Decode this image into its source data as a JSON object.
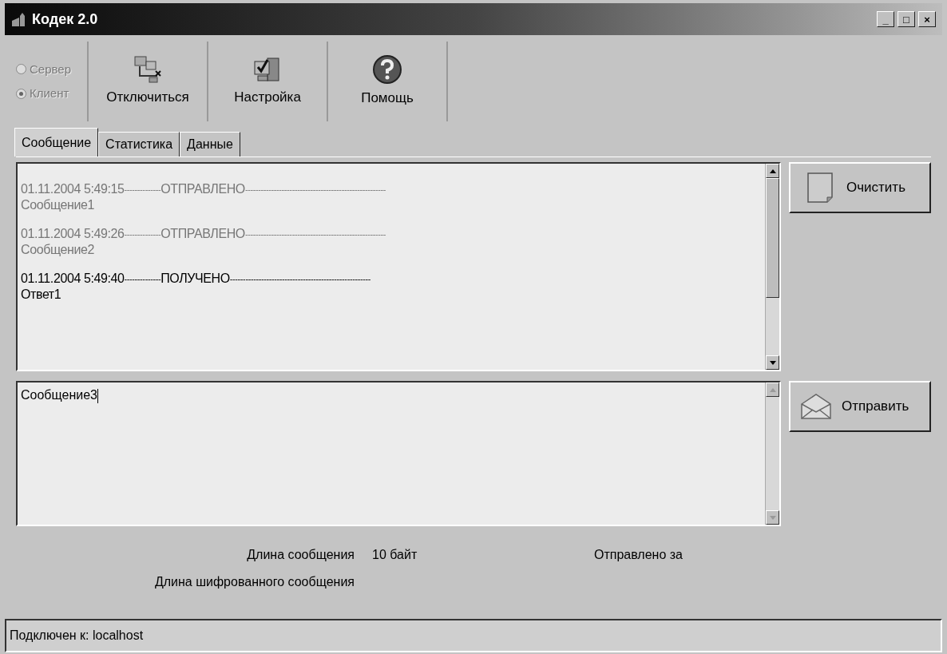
{
  "window": {
    "title": "Кодек 2.0",
    "controls": [
      "_",
      "□",
      "×"
    ]
  },
  "mode": [
    {
      "label": "Сервер",
      "selected": false,
      "disabled": true
    },
    {
      "label": "Клиент",
      "selected": true,
      "disabled": true
    }
  ],
  "toolbar": [
    {
      "label": "Отключиться",
      "kind": "disconnect"
    },
    {
      "label": "Настройка",
      "kind": "settings"
    },
    {
      "label": "Помощь",
      "kind": "help"
    }
  ],
  "tabs": [
    {
      "label": "Сообщение",
      "selected": true
    },
    {
      "label": "Статистика",
      "selected": false
    },
    {
      "label": "Данные",
      "selected": false
    }
  ],
  "log": {
    "scroll_enabled": true,
    "entries": [
      {
        "kind": "sent",
        "time": "01.11.2004 5:49:15",
        "left_dashes": "--------------",
        "status": "ОТПРАВЛЕНО",
        "right_dashes": "------------------------------------------------------",
        "text": "Сообщение1"
      },
      {
        "kind": "sent",
        "time": "01.11.2004 5:49:26",
        "left_dashes": "--------------",
        "status": "ОТПРАВЛЕНО",
        "right_dashes": "------------------------------------------------------",
        "text": "Сообщение2"
      },
      {
        "kind": "received",
        "time": "01.11.2004 5:49:40",
        "left_dashes": "--------------",
        "status": "ПОЛУЧЕНО",
        "right_dashes": "------------------------------------------------------",
        "text": "Ответ1"
      }
    ]
  },
  "clear_button": "Очистить",
  "input": {
    "value": "Сообщение3",
    "scroll_enabled": false
  },
  "send_button": "Отправить",
  "info": {
    "length_label": "Длина сообщения",
    "length_value": "10 байт",
    "encrypted_label": "Длина шифрованного сообщения",
    "sent_label": "Отправлено за"
  },
  "status_bar": "Подключен к: localhost"
}
